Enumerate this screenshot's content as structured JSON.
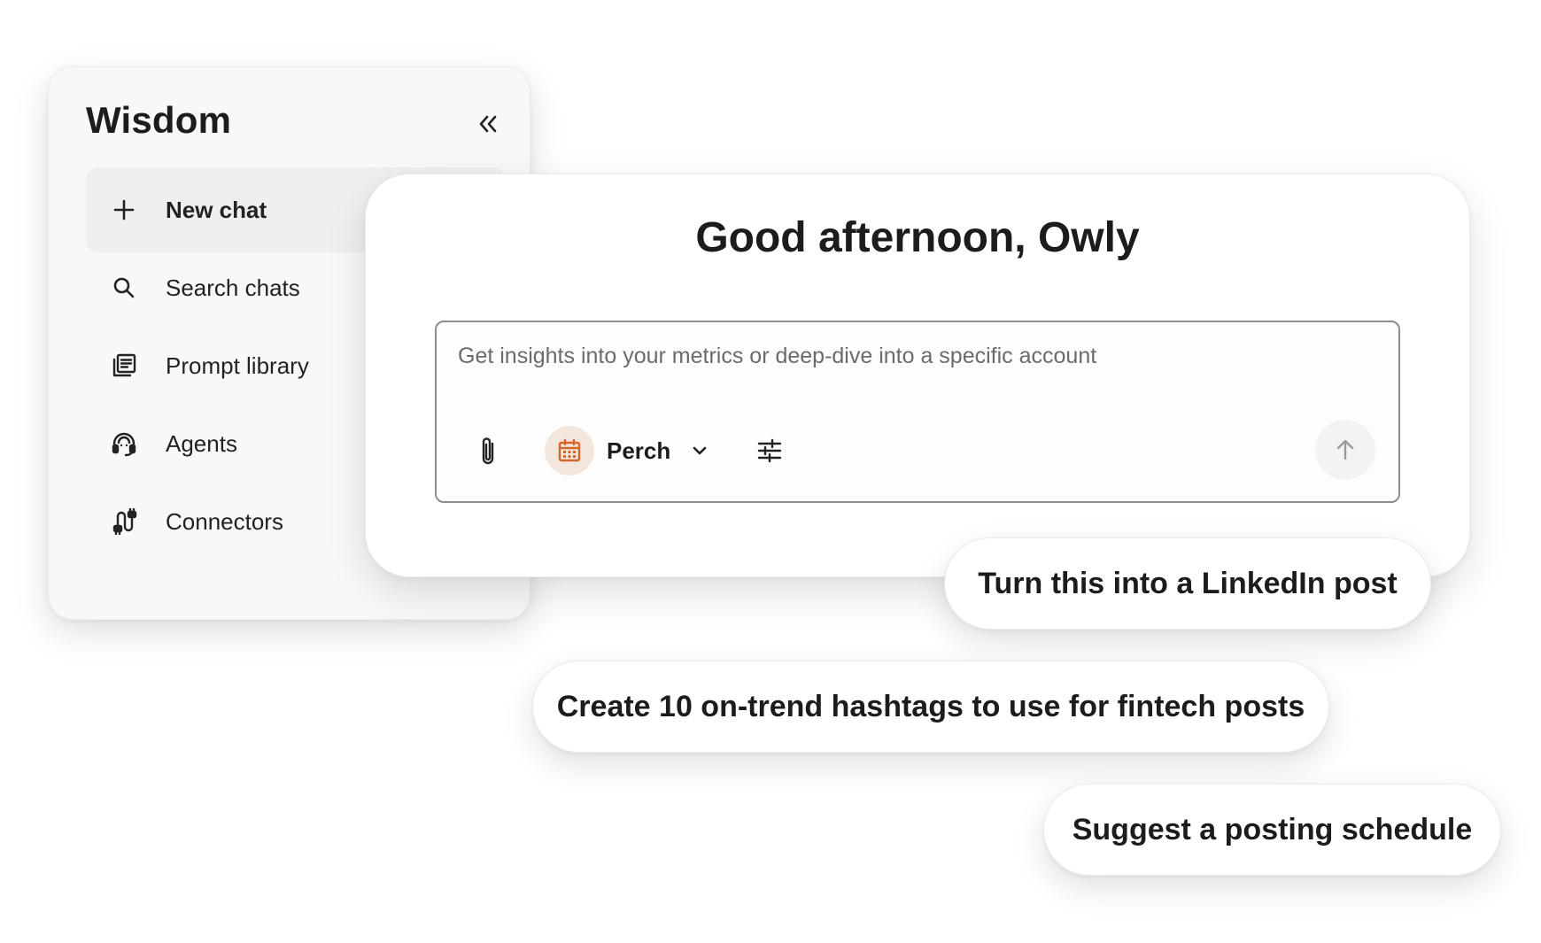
{
  "sidebar": {
    "title": "Wisdom",
    "collapse_icon": "double-chevron-left-icon",
    "items": [
      {
        "label": "New chat",
        "icon": "plus-icon",
        "active": true
      },
      {
        "label": "Search chats",
        "icon": "search-icon",
        "active": false
      },
      {
        "label": "Prompt library",
        "icon": "library-icon",
        "active": false
      },
      {
        "label": "Agents",
        "icon": "agent-headset-icon",
        "active": false
      },
      {
        "label": "Connectors",
        "icon": "connectors-icon",
        "active": false
      }
    ]
  },
  "main": {
    "greeting": "Good afternoon, Owly",
    "composer": {
      "placeholder": "Get insights into your metrics or deep-dive into a specific account",
      "value": "",
      "attach_icon": "paperclip-icon",
      "account": {
        "name": "Perch",
        "icon": "calendar-icon",
        "accent_color": "#d4662a",
        "avatar_bg": "#f3e6dd"
      },
      "settings_icon": "sliders-icon",
      "send_icon": "arrow-up-icon"
    }
  },
  "suggestions": [
    "Turn this into a LinkedIn post",
    "Create 10 on-trend hashtags to use for fintech posts",
    "Suggest a posting schedule"
  ]
}
